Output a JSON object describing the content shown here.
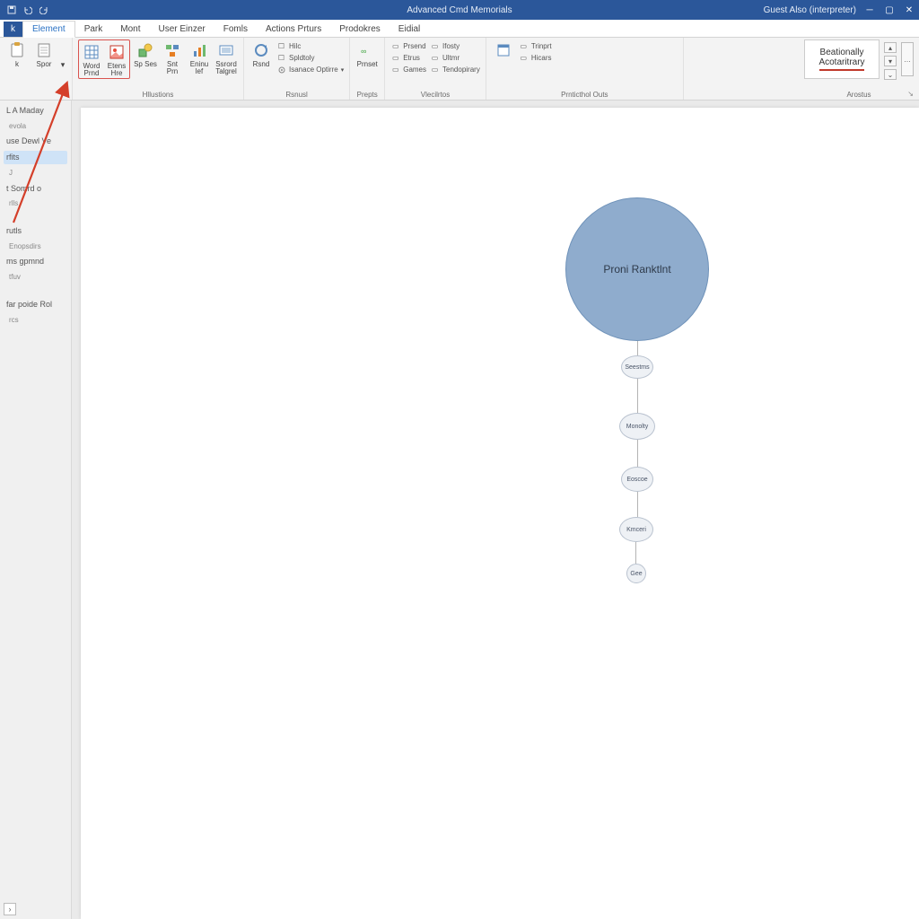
{
  "title_bar": {
    "doc_title": "Advanced Cmd Memorials",
    "user_label": "Guest Also (interpreter)"
  },
  "tabs": {
    "file": "k",
    "items": [
      "Element",
      "Park",
      "Mont",
      "User Einzer",
      "Fomls",
      "Actions Prturs",
      "Prodokres",
      "Eidial"
    ],
    "active_index": 0
  },
  "ribbon": {
    "group1": {
      "btnA": "k",
      "btnB": "Spor",
      "label": ""
    },
    "group2": {
      "btnA": "Word Prnd",
      "btnB": "Etens Hre",
      "btnC": "Sp Ses",
      "btnD": "Snt Prn",
      "btnE": "Eninu lef",
      "btnF": "Ssrord Talgrel",
      "label": "Hllustions"
    },
    "group3": {
      "btnA": "Rsnd",
      "miniA": "Hilc",
      "miniB": "Spldtoly",
      "dropdown": "Isanace Optirre",
      "label": "Rsnusl"
    },
    "group4": {
      "btnA": "Prnset",
      "label": "Prepts"
    },
    "group5": {
      "miniA": "Prsend",
      "miniB": "Etrus",
      "miniC": "Games",
      "miniD": "Ifosty",
      "miniE": "Ultmr",
      "miniF": "Tendopirary",
      "label": "Vlecilrtos"
    },
    "group6": {
      "btnA": "",
      "miniA": "Trinprt",
      "miniB": "Hicars",
      "label": "Prnticthol Outs"
    },
    "styles": {
      "line1": "Beationally",
      "line2": "Acotaritrary",
      "label": "Arostus"
    }
  },
  "nav": {
    "items": [
      {
        "label": "L A Maday",
        "sel": false
      },
      {
        "label": "evola",
        "sel": false,
        "sub": true
      },
      {
        "label": "use Dewl Ve",
        "sel": false
      },
      {
        "label": "rfits",
        "sel": true
      },
      {
        "label": "J",
        "sel": false,
        "sub": true
      },
      {
        "label": "t Somrd o",
        "sel": false
      },
      {
        "label": "rlls",
        "sel": false,
        "sub": true
      }
    ],
    "items2": [
      {
        "label": "rutls"
      },
      {
        "label": "Enopsdirs",
        "sub": true
      },
      {
        "label": "ms gpmnd"
      },
      {
        "label": "tfuv",
        "sub": true
      },
      {
        "label": "far poide Rol"
      },
      {
        "label": "rcs",
        "sub": true
      }
    ]
  },
  "smartart": {
    "main": "Proni Ranktlnt",
    "nodes": [
      "Seestms",
      "Monolty",
      "Eoscoe",
      "Kmceri",
      "Gee"
    ]
  },
  "colors": {
    "accent": "#2b579a",
    "tab_active": "#2b72c4",
    "circle_fill": "#8faccd",
    "circle_stroke": "#6f92b9",
    "arrow": "#d43f2a"
  }
}
